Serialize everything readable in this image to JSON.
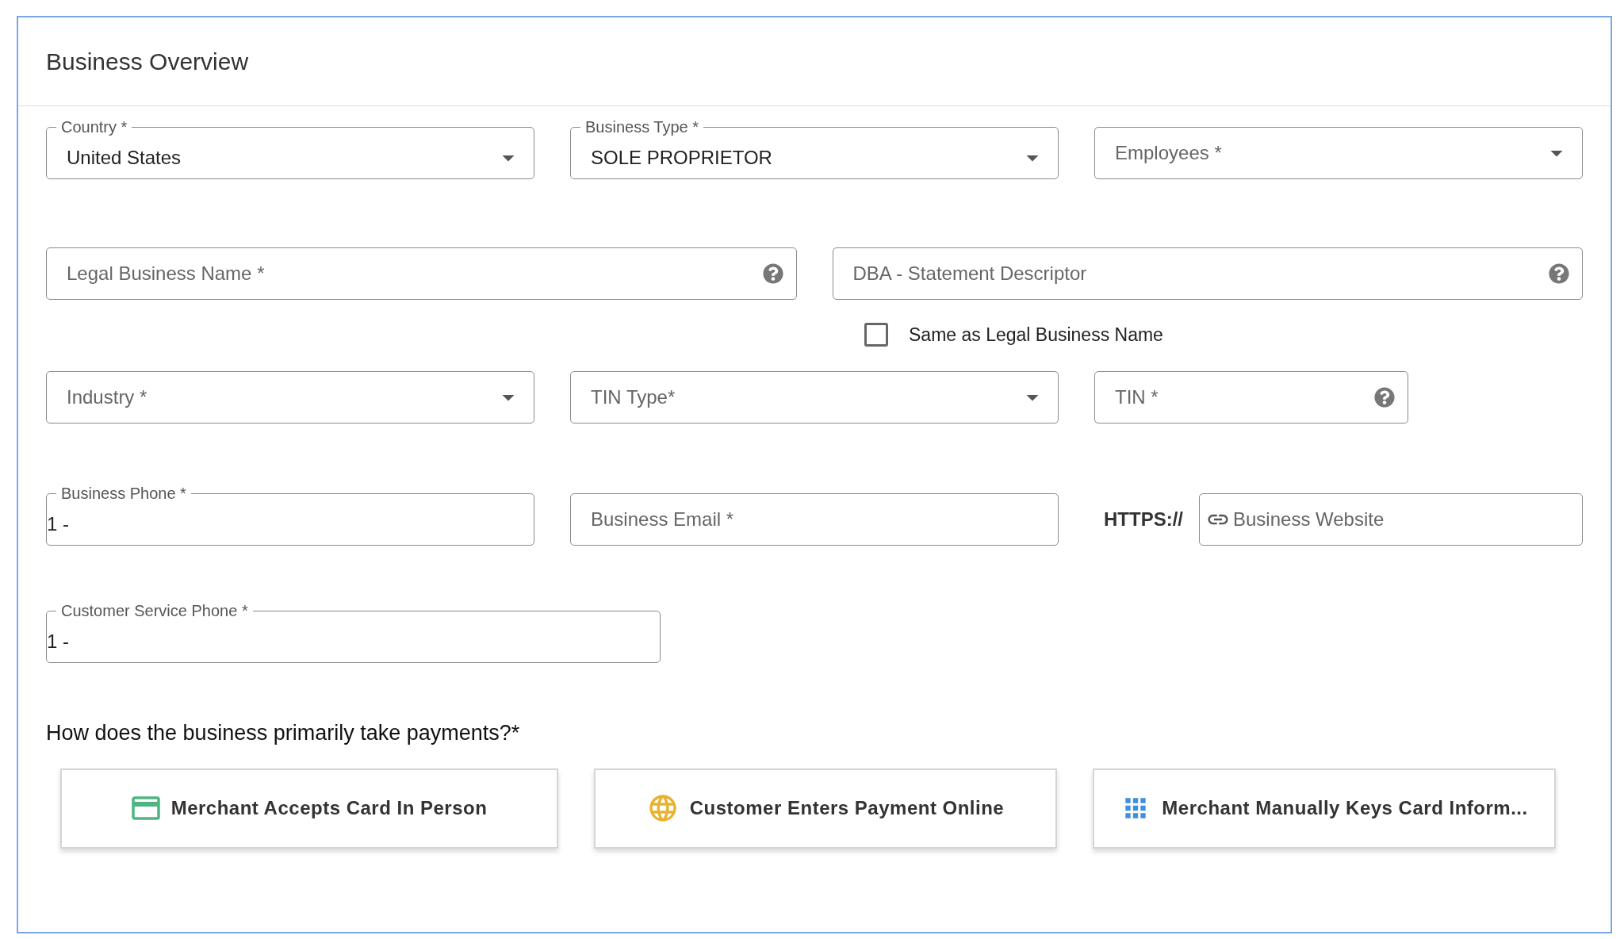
{
  "title": "Business Overview",
  "row_1": [
    {
      "kind": "select",
      "label": "Country *",
      "value": "United States"
    },
    {
      "kind": "select",
      "label": "Business Type *",
      "value": "SOLE PROPRIETOR"
    },
    {
      "kind": "select",
      "placeholder": "Employees *"
    }
  ],
  "row_2": [
    {
      "kind": "text",
      "placeholder": "Legal Business Name *",
      "help": true
    },
    {
      "kind": "text",
      "placeholder": "DBA - Statement Descriptor",
      "help": true
    }
  ],
  "same_as_legal": {
    "label": "Same as Legal Business Name",
    "checked": false
  },
  "row_3": [
    {
      "kind": "select",
      "placeholder": "Industry *"
    },
    {
      "kind": "select",
      "placeholder": "TIN Type*"
    },
    {
      "kind": "text",
      "placeholder": "TIN *",
      "help": true
    }
  ],
  "row_4": [
    {
      "kind": "text",
      "label": "Business Phone *",
      "value": "1 -"
    },
    {
      "kind": "text",
      "placeholder": "Business Email *"
    },
    {
      "kind": "url",
      "prefix": "HTTPS://",
      "placeholder": "Business Website"
    }
  ],
  "row_5": [
    {
      "kind": "text",
      "label": "Customer Service Phone *",
      "value": "1 -"
    }
  ],
  "payment_question": "How does the business primarily take payments?*",
  "payment_options": [
    {
      "kind": "card",
      "label": "Merchant Accepts Card In Person"
    },
    {
      "kind": "globe",
      "label": "Customer Enters Payment Online"
    },
    {
      "kind": "grid",
      "label": "Merchant Manually Keys Card Inform..."
    }
  ]
}
